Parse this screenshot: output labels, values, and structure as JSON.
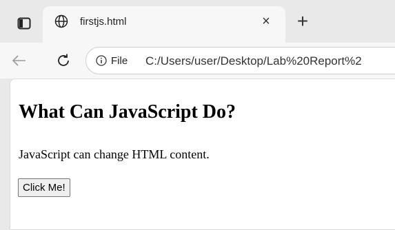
{
  "browser": {
    "tab": {
      "title": "firstjs.html",
      "close_glyph": "×",
      "favicon": "globe-icon"
    },
    "new_tab_glyph": "+",
    "address_bar": {
      "scheme_label": "File",
      "url": "C:/Users/user/Desktop/Lab%20Report%2"
    },
    "icons": [
      "tab-actions-icon",
      "back-arrow-icon",
      "reload-icon",
      "info-icon"
    ]
  },
  "page": {
    "heading": "What Can JavaScript Do?",
    "paragraph": "JavaScript can change HTML content.",
    "button_label": "Click Me!"
  },
  "colors": {
    "chrome_bg": "#e9e9e9",
    "active_tab_bg": "#f7f7f7",
    "page_bg": "#ffffff"
  }
}
